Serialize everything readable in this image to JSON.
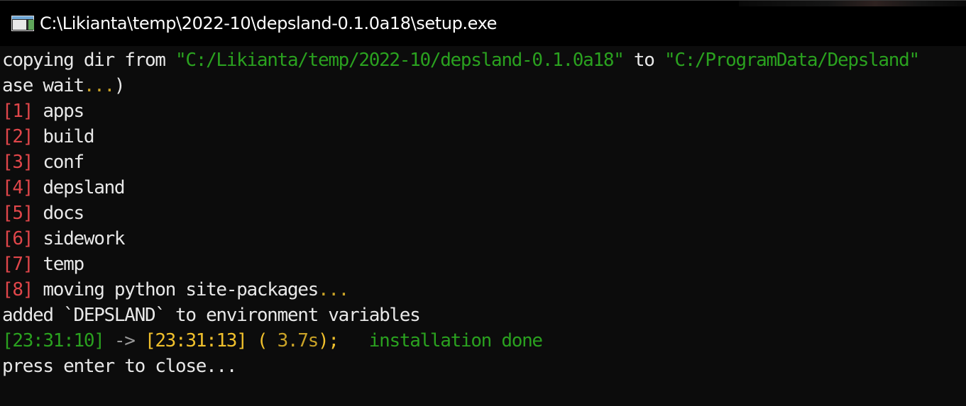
{
  "window": {
    "title": "C:\\Likianta\\temp\\2022-10\\depsland-0.1.0a18\\setup.exe",
    "icon": "console-window-icon"
  },
  "console": {
    "line1": {
      "prefix": "copying dir from ",
      "src": "\"C:/Likianta/temp/2022-10/depsland-0.1.0a18\"",
      "mid": " to ",
      "dst": "\"C:/ProgramData/Depsland\""
    },
    "line2": {
      "text": "ase wait",
      "dots": "...",
      "close": ")"
    },
    "items": [
      {
        "index": "[1]",
        "name": "apps"
      },
      {
        "index": "[2]",
        "name": "build"
      },
      {
        "index": "[3]",
        "name": "conf"
      },
      {
        "index": "[4]",
        "name": "depsland"
      },
      {
        "index": "[5]",
        "name": "docs"
      },
      {
        "index": "[6]",
        "name": "sidework"
      },
      {
        "index": "[7]",
        "name": "temp"
      },
      {
        "index": "[8]",
        "name": "moving python site-packages",
        "dots": "..."
      }
    ],
    "env_line": "added `DEPSLAND` to environment variables",
    "timing": {
      "start": "[23:31:10]",
      "arrow": " -> ",
      "end": "[23:31:13]",
      "paren_open": " ( ",
      "duration": "3.7s",
      "paren_close": ");",
      "status": "installation done"
    },
    "prompt": "press enter to close..."
  },
  "colors": {
    "background": "#0c0c0c",
    "path_green": "#2aa11f",
    "index_red": "#e0464a",
    "dots_yellow": "#c9a227",
    "time_yellow": "#f0c02c"
  }
}
